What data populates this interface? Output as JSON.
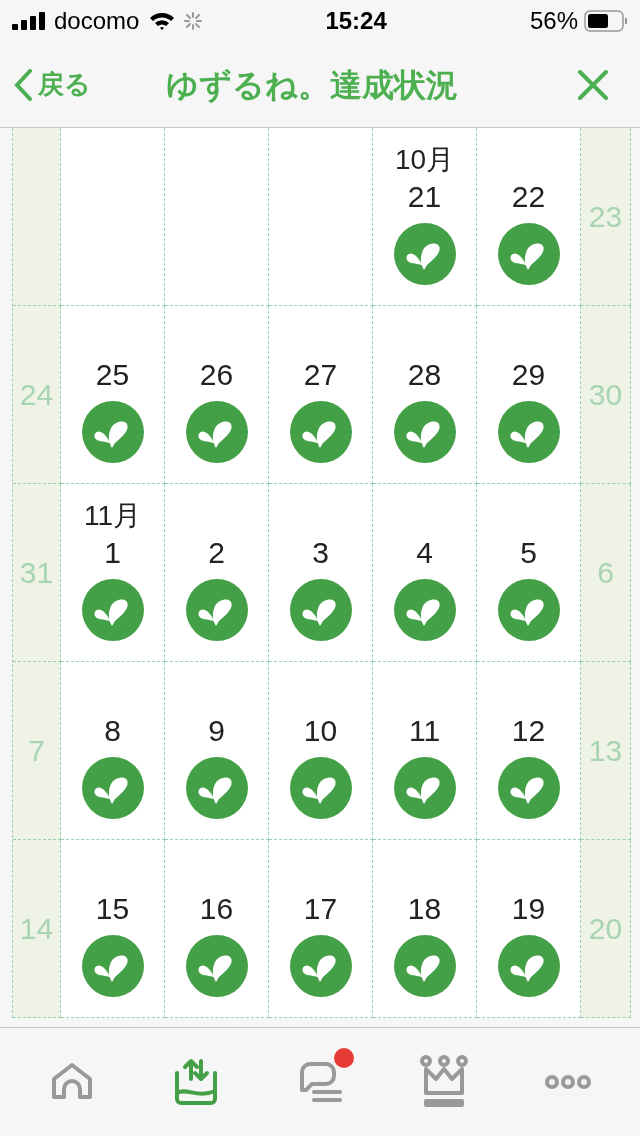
{
  "status_bar": {
    "carrier": "docomo",
    "time": "15:24",
    "battery": "56%"
  },
  "nav": {
    "back": "戻る",
    "title": "ゆずるね。達成状況"
  },
  "weeks": [
    {
      "days": [
        {
          "kind": "weekend"
        },
        {
          "kind": "blank"
        },
        {
          "kind": "blank"
        },
        {
          "kind": "blank"
        },
        {
          "kind": "day",
          "month": "10月",
          "day": "21",
          "achieved": true
        },
        {
          "kind": "day",
          "day": "22",
          "achieved": true
        },
        {
          "kind": "weekend",
          "day": "23"
        }
      ]
    },
    {
      "days": [
        {
          "kind": "weekend",
          "day": "24"
        },
        {
          "kind": "day",
          "day": "25",
          "achieved": true
        },
        {
          "kind": "day",
          "day": "26",
          "achieved": true
        },
        {
          "kind": "day",
          "day": "27",
          "achieved": true
        },
        {
          "kind": "day",
          "day": "28",
          "achieved": true
        },
        {
          "kind": "day",
          "day": "29",
          "achieved": true
        },
        {
          "kind": "weekend",
          "day": "30"
        }
      ]
    },
    {
      "days": [
        {
          "kind": "weekend",
          "day": "31"
        },
        {
          "kind": "day",
          "month": "11月",
          "day": "1",
          "achieved": true
        },
        {
          "kind": "day",
          "day": "2",
          "achieved": true
        },
        {
          "kind": "day",
          "day": "3",
          "achieved": true
        },
        {
          "kind": "day",
          "day": "4",
          "achieved": true
        },
        {
          "kind": "day",
          "day": "5",
          "achieved": true
        },
        {
          "kind": "weekend",
          "day": "6"
        }
      ]
    },
    {
      "days": [
        {
          "kind": "weekend",
          "day": "7"
        },
        {
          "kind": "day",
          "day": "8",
          "achieved": true
        },
        {
          "kind": "day",
          "day": "9",
          "achieved": true
        },
        {
          "kind": "day",
          "day": "10",
          "achieved": true
        },
        {
          "kind": "day",
          "day": "11",
          "achieved": true
        },
        {
          "kind": "day",
          "day": "12",
          "achieved": true
        },
        {
          "kind": "weekend",
          "day": "13"
        }
      ]
    },
    {
      "days": [
        {
          "kind": "weekend",
          "day": "14"
        },
        {
          "kind": "day",
          "day": "15",
          "achieved": true
        },
        {
          "kind": "day",
          "day": "16",
          "achieved": true
        },
        {
          "kind": "day",
          "day": "17",
          "achieved": true
        },
        {
          "kind": "day",
          "day": "18",
          "achieved": true
        },
        {
          "kind": "day",
          "day": "19",
          "achieved": true
        },
        {
          "kind": "weekend",
          "day": "20"
        }
      ]
    }
  ],
  "tabs": [
    {
      "kind": "home",
      "selected": false,
      "badge": false
    },
    {
      "kind": "exchange",
      "selected": true,
      "badge": false
    },
    {
      "kind": "chat",
      "selected": false,
      "badge": true
    },
    {
      "kind": "crown",
      "selected": false,
      "badge": false
    },
    {
      "kind": "more",
      "selected": false,
      "badge": false
    }
  ]
}
